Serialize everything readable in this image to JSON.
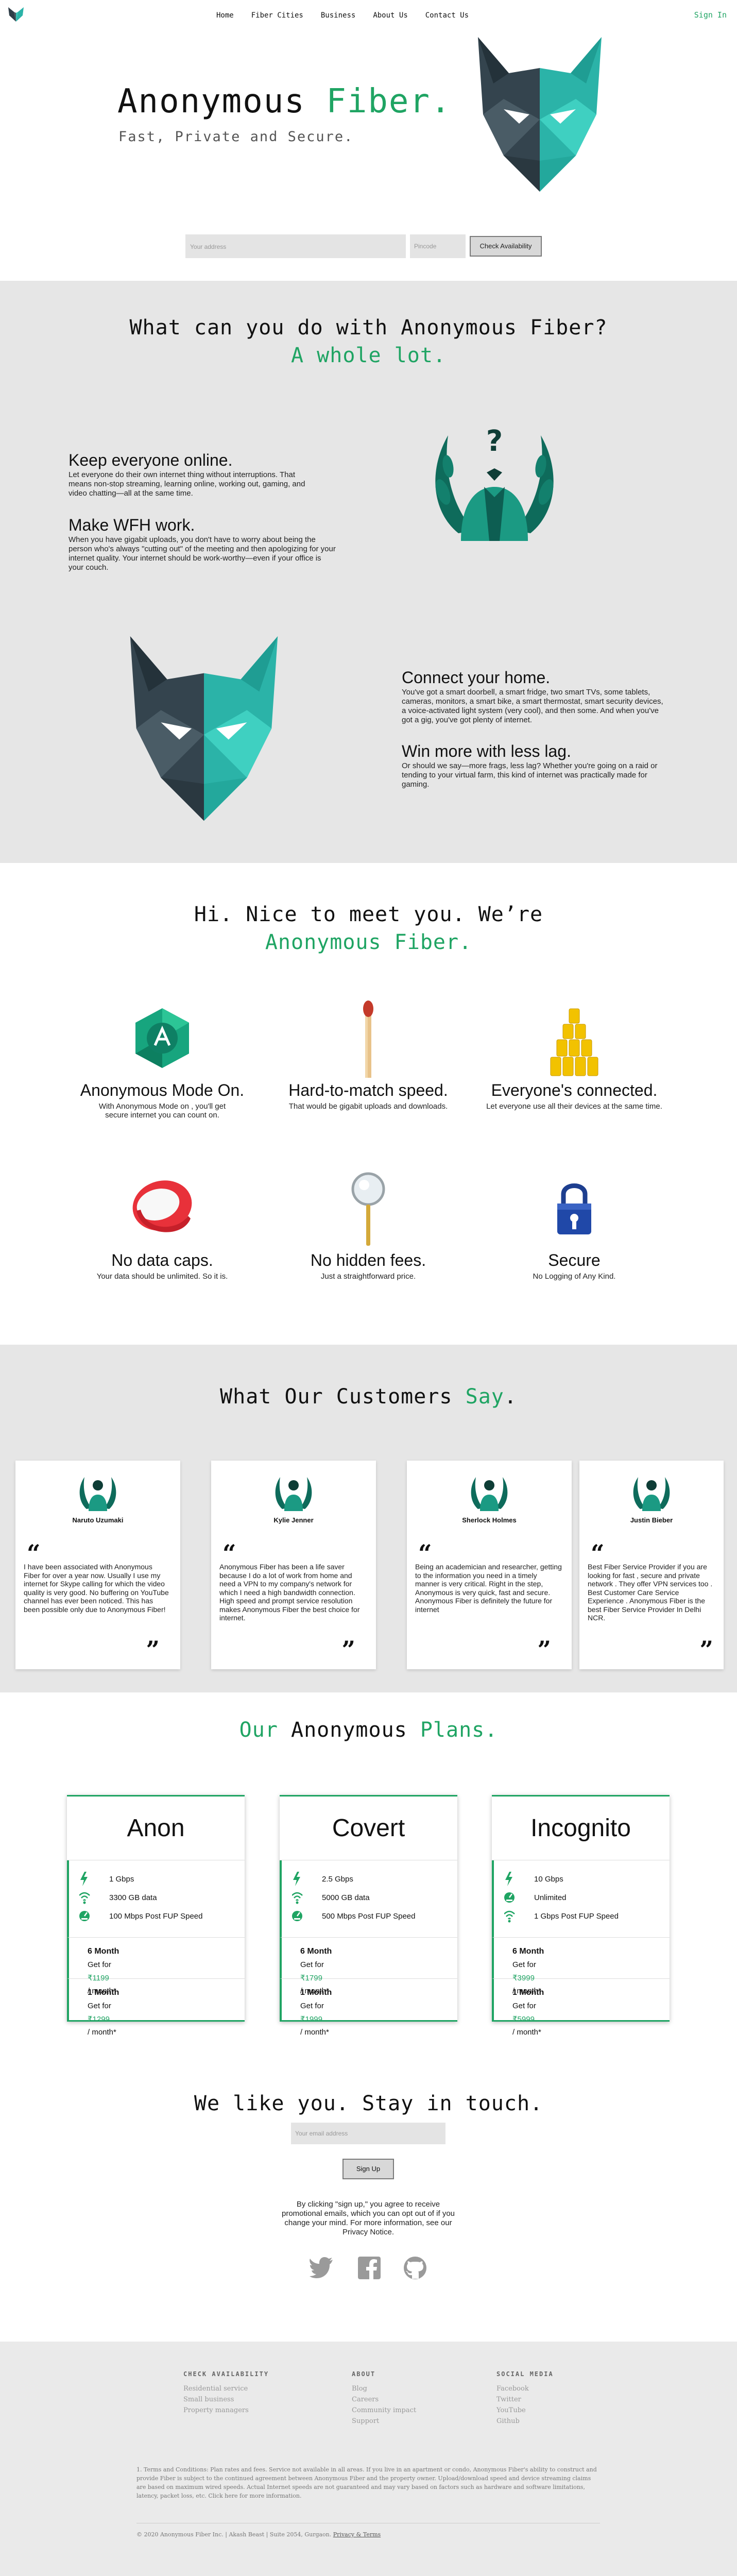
{
  "nav": {
    "items": [
      "Home",
      "Fiber Cities",
      "Business",
      "About Us",
      "Contact Us"
    ],
    "signin": "Sign In"
  },
  "hero": {
    "title_a": "Anonymous",
    "title_b": "Fiber.",
    "subtitle": "Fast, Private and Secure.",
    "address_placeholder": "Your address",
    "pincode_placeholder": "Pincode",
    "check_label": "Check Availability"
  },
  "features": {
    "title": "What can you do with Anonymous Fiber?",
    "subtitle": "A whole lot.",
    "items": [
      {
        "heading": "Keep everyone online.",
        "text": "Let everyone do their own internet thing without interruptions. That means non-stop streaming, learning online, working out, gaming, and video chatting—all at the same time."
      },
      {
        "heading": "Make WFH work.",
        "text": "When you have gigabit uploads, you don't have to worry about being the person who's always \"cutting out\" of the meeting and then apologizing for your internet quality. Your internet should be work-worthy—even if your office is your couch."
      },
      {
        "heading": "Connect your home.",
        "text": "You've got a smart doorbell, a smart fridge, two smart TVs, some tablets, cameras, monitors, a smart bike, a smart thermostat, smart security devices, a voice-activated light system (very cool), and then some. And when you've got a gig, you've got plenty of internet."
      },
      {
        "heading": "Win more with less lag.",
        "text": "Or should we say—more frags, less lag? Whether you're going on a raid or tending to your virtual farm, this kind of internet was practically made for gaming."
      }
    ]
  },
  "meet": {
    "title": "Hi. Nice to meet you. We’re",
    "subtitle": "Anonymous Fiber.",
    "items": [
      {
        "title": "Anonymous Mode On.",
        "text": "With Anonymous Mode on , you'll get secure internet you can count on."
      },
      {
        "title": "Hard-to-match speed.",
        "text": "That would be gigabit uploads and downloads."
      },
      {
        "title": "Everyone's connected.",
        "text": "Let everyone use all their devices at the same time."
      },
      {
        "title": "No data caps.",
        "text": "Your data should be unlimited. So it is."
      },
      {
        "title": "No hidden fees.",
        "text": "Just a straightforward price."
      },
      {
        "title": "Secure",
        "text": "No Logging of Any Kind."
      }
    ]
  },
  "customers": {
    "title_a": "What Our Customers",
    "title_b": "Say",
    "title_c": ".",
    "reviews": [
      {
        "name": "Naruto Uzumaki",
        "text": "I have been associated with Anonymous Fiber for over a year now. Usually I use my internet for Skype calling for which the video quality is very good. No buffering on YouTube channel has ever been noticed. This has been possible only due to Anonymous Fiber!"
      },
      {
        "name": "Kylie Jenner",
        "text": "Anonymous Fiber has been a life saver because I do a lot of work from home and need a VPN to my company's network for which I need a high bandwidth connection. High speed and prompt service resolution makes Anonymous Fiber the best choice for internet."
      },
      {
        "name": "Sherlock Holmes",
        "text": "Being an academician and researcher, getting to the information you need in a timely manner is very critical. Right in the step, Anonymous is very quick, fast and secure. Anonymous Fiber is definitely the future for internet"
      },
      {
        "name": "Justin Bieber",
        "text": "Best Fiber Service Provider if you are looking for fast , secure and private network . They offer VPN services too . Best Customer Care Service Experience . Anonymous Fiber is the best Fiber Service Provider In Delhi NCR."
      }
    ]
  },
  "plans": {
    "title_a": "Our",
    "title_b": "Anonymous",
    "title_c": "Plans.",
    "get_for": "Get for",
    "per_month": "/ month*",
    "cards": [
      {
        "name": "Anon",
        "speed": "1 Gbps",
        "data": "3300 GB data",
        "fup": "100 Mbps Post FUP Speed",
        "p6_label": "6 Month",
        "p6_price": "₹1199",
        "p1_label": "1 Month",
        "p1_price": "₹1299"
      },
      {
        "name": "Covert",
        "speed": "2.5 Gbps",
        "data": "5000 GB data",
        "fup": "500 Mbps Post FUP Speed",
        "p6_label": "6 Month",
        "p6_price": "₹1799",
        "p1_label": "1 Month",
        "p1_price": "₹1999"
      },
      {
        "name": "Incognito",
        "speed": "10 Gbps",
        "data": "Unlimited",
        "fup": "1 Gbps Post FUP Speed",
        "p6_label": "6 Month",
        "p6_price": "₹3999",
        "p1_label": "1 Month",
        "p1_price": "₹5999"
      }
    ]
  },
  "stay": {
    "title": "We like you. Stay in touch.",
    "email_placeholder": "Your email address",
    "signup": "Sign Up",
    "note": "By clicking \"sign up,\" you agree to receive promotional emails, which you can opt out of if you change your mind. For more information, see our Privacy Notice."
  },
  "footer": {
    "cols": [
      {
        "heading": "CHECK AVAILABILITY",
        "links": [
          "Residential service",
          "Small business",
          "Property managers"
        ]
      },
      {
        "heading": "ABOUT",
        "links": [
          "Blog",
          "Careers",
          "Community impact",
          "Support"
        ]
      },
      {
        "heading": "SOCIAL MEDIA",
        "links": [
          "Facebook",
          "Twitter",
          "YouTube",
          "Github"
        ]
      }
    ],
    "legal": "1. Terms and Conditions: Plan rates and fees. Service not available in all areas. If you live in an apartment or condo, Anonymous Fiber's ability to construct and provide Fiber is subject to the continued agreement between Anonymous Fiber and the property owner. Upload/download speed and device streaming claims are based on maximum wired speeds. Actual Internet speeds are not guaranteed and may vary based on factors such as hardware and software limitations, latency, packet loss, etc. Click here for more information.",
    "copyright": "© 2020 Anonymous Fiber Inc. | Akash Beast | Suite 2054, Gurgaon.",
    "privacy": "Privacy & Terms"
  }
}
